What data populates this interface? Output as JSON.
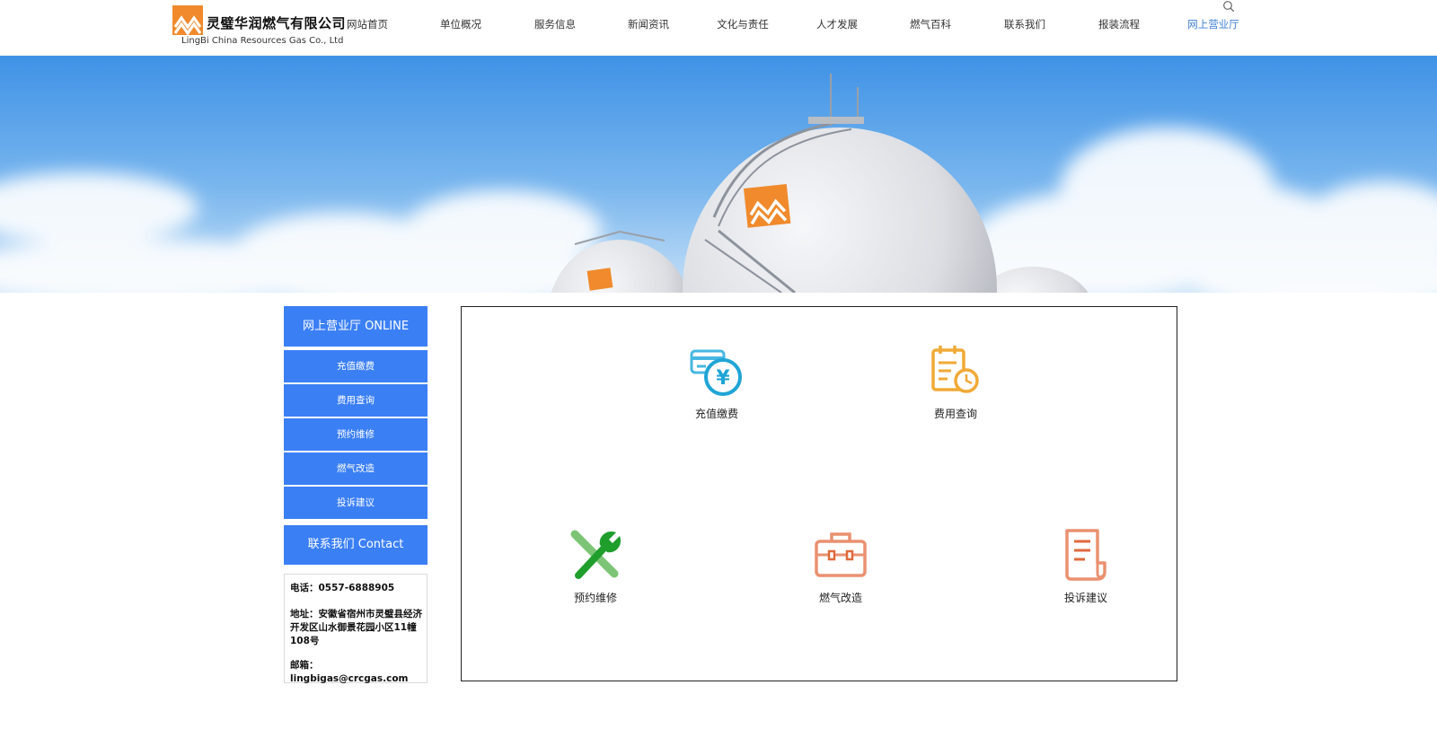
{
  "brand": {
    "name_cn": "灵璧华润燃气有限公司",
    "name_en": "LingBi China Resources Gas Co., Ltd",
    "accent": "#f08a2c"
  },
  "nav": {
    "items": [
      {
        "label": "网站首页",
        "active": false
      },
      {
        "label": "单位概况",
        "active": false
      },
      {
        "label": "服务信息",
        "active": false
      },
      {
        "label": "新闻资讯",
        "active": false
      },
      {
        "label": "文化与责任",
        "active": false
      },
      {
        "label": "人才发展",
        "active": false
      },
      {
        "label": "燃气百科",
        "active": false
      },
      {
        "label": "联系我们",
        "active": false
      },
      {
        "label": "报装流程",
        "active": false
      },
      {
        "label": "网上营业厅",
        "active": true
      }
    ],
    "active_color": "#3f7fd6",
    "search_icon": "search-icon"
  },
  "sidebar": {
    "online_title": "网上营业厅 ONLINE",
    "links": [
      "充值缴费",
      "费用查询",
      "预约维修",
      "燃气改造",
      "投诉建议"
    ],
    "contact_title": "联系我们 Contact",
    "color": "#3b7ff5"
  },
  "contact": {
    "phone": "电话：0557-6888905",
    "address": "地址：安徽省宿州市灵璧县经济开发区山水御景花园小区11幢108号",
    "email": "邮箱：lingbigas@crcgas.com"
  },
  "services": [
    {
      "label": "充值缴费",
      "icon": "recharge-payment-icon"
    },
    {
      "label": "费用查询",
      "icon": "fee-inquiry-icon"
    },
    {
      "label": "预约维修",
      "icon": "repair-wrench-icon"
    },
    {
      "label": "燃气改造",
      "icon": "toolbox-icon"
    },
    {
      "label": "投诉建议",
      "icon": "document-icon"
    }
  ]
}
